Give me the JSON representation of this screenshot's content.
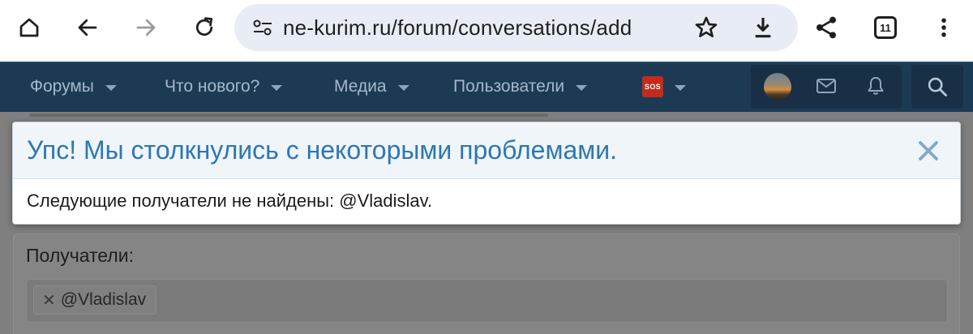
{
  "browser": {
    "url": "ne-kurim.ru/forum/conversations/add",
    "tab_count": "11",
    "icons": [
      "home-icon",
      "back-icon",
      "forward-icon",
      "reload-icon",
      "site-settings-icon",
      "star-icon",
      "download-icon",
      "share-icon",
      "tabs-icon",
      "more-menu-icon"
    ]
  },
  "nav": {
    "items": [
      {
        "label": "Форумы"
      },
      {
        "label": "Что нового?"
      },
      {
        "label": "Медиа"
      },
      {
        "label": "Пользователи"
      }
    ],
    "sos_badge": "SOS",
    "colors": {
      "background": "#1d3a55",
      "text": "#a4b8cb"
    }
  },
  "dialog": {
    "title": "Упс! Мы столкнулись с некоторыми проблемами.",
    "message": "Следующие получатели не найдены: @Vladislav.",
    "colors": {
      "title": "#2d77b3",
      "header_bg": "#f0f5fa"
    }
  },
  "form": {
    "recipients_label": "Получатели:",
    "recipient_token": "@Vladislav"
  }
}
